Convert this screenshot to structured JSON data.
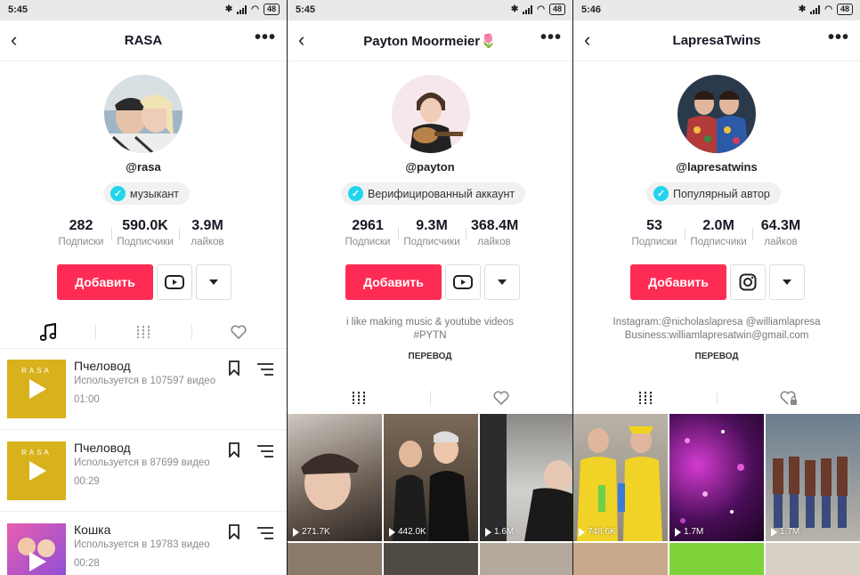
{
  "status": {
    "battery": "48"
  },
  "screens": [
    {
      "time": "5:45",
      "title": "RASA",
      "handle": "@rasa",
      "badge": "музыкант",
      "stats": [
        {
          "num": "282",
          "label": "Подписки"
        },
        {
          "num": "590.0K",
          "label": "Подписчики"
        },
        {
          "num": "3.9M",
          "label": "лайков"
        }
      ],
      "follow_label": "Добавить",
      "social_icon": "youtube-icon",
      "tabs": [
        "music-note-icon",
        "grid-icon",
        "heart-icon"
      ],
      "music": [
        {
          "title": "Пчеловод",
          "used": "Используется в 107597 видео",
          "duration": "01:00",
          "cover_text": "RASA"
        },
        {
          "title": "Пчеловод",
          "used": "Используется в 87699 видео",
          "duration": "00:29",
          "cover_text": "RASA"
        },
        {
          "title": "Кошка",
          "used": "Используется в 19783 видео",
          "duration": "00:28"
        }
      ]
    },
    {
      "time": "5:45",
      "title": "Payton Moormeier🌷",
      "handle": "@payton",
      "badge": "Верифицированный аккаунт",
      "stats": [
        {
          "num": "2961",
          "label": "Подписки"
        },
        {
          "num": "9.3M",
          "label": "Подписчики"
        },
        {
          "num": "368.4M",
          "label": "лайков"
        }
      ],
      "follow_label": "Добавить",
      "social_icon": "youtube-icon",
      "bio": [
        "i like making music & youtube videos",
        "#PYTN"
      ],
      "translate": "ПЕРЕВОД",
      "tabs": [
        "grid-icon",
        "heart-icon"
      ],
      "videos": [
        "271.7K",
        "442.0K",
        "1.6M"
      ]
    },
    {
      "time": "5:46",
      "title": "LapresaTwins",
      "handle": "@lapresatwins",
      "badge": "Популярный автор",
      "stats": [
        {
          "num": "53",
          "label": "Подписки"
        },
        {
          "num": "2.0M",
          "label": "Подписчики"
        },
        {
          "num": "64.3M",
          "label": "лайков"
        }
      ],
      "follow_label": "Добавить",
      "social_icon": "instagram-icon",
      "bio": [
        "Instagram:@nicholaslapresa @williamlapresa",
        "Business:williamlapresatwin@gmail.com"
      ],
      "translate": "ПЕРЕВОД",
      "tabs": [
        "grid-icon",
        "heart-lock-icon"
      ],
      "videos": [
        "748.6K",
        "1.7M",
        "1.7M"
      ]
    }
  ],
  "colors": {
    "accent": "#fe2c55",
    "verified": "#20d5ec"
  }
}
